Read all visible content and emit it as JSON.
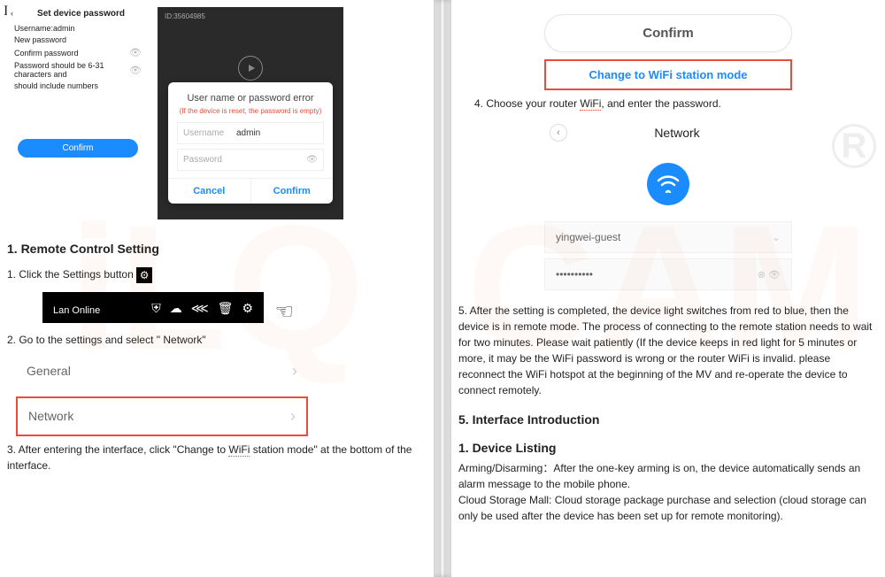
{
  "left": {
    "phone_a": {
      "title": "Set device password",
      "username": "Username:admin",
      "newpw": "New password",
      "confpw": "Confirm password",
      "hint1": "Password should be 6-31 characters and",
      "hint2": "should include numbers",
      "confirm_btn": "Confirm"
    },
    "phone_b": {
      "id_label": "ID:35604985",
      "dialog_title": "User name or password error",
      "dialog_red": "(If the device is reset, the password is empty)",
      "u_lbl": "Username",
      "u_val": "admin",
      "p_lbl": "Password",
      "cancel": "Cancel",
      "confirm": "Confirm"
    },
    "section1_h": "1. Remote Control Setting",
    "step1": "1. Click the Settings button",
    "bar_label": "Lan  Online",
    "step2": "2. Go to the settings    and select \" Network\"",
    "li_general": "General",
    "li_network": "Network",
    "step3a": "3.   After entering the interface, click \"Change to ",
    "step3_wifi": "WiFi",
    "step3b": " station mode\" at the bottom of the interface."
  },
  "right": {
    "confirm_pill": "Confirm",
    "change_mode": "Change to WiFi station mode",
    "step4a": "4.    Choose your router ",
    "step4_wifi": "WiFi",
    "step4b": ", and enter the password.",
    "net_title": "Network",
    "ssid": "yingwei-guest",
    "pw_dots": "••••••••••",
    "step5": "5. After the setting is completed, the device light switches from red to blue, then the device is in remote mode. The process of connecting to the remote station needs to wait for two minutes. Please wait patiently (If the device keeps in red light for 5 minutes or more, it may be the WiFi password is wrong or the router WiFi is invalid. please reconnect the WiFi hotspot at the beginning of the MV and re-operate the device to connect remotely.",
    "h_interface": "5. Interface Introduction",
    "h_listing": "1. Device Listing",
    "listing_body": "Arming/Disarming：After the one-key arming is on, the device automatically sends an alarm message to the mobile phone.\nCloud Storage Mall: Cloud storage package purchase and selection (cloud storage can only be used after the device has been set up for remote monitoring)."
  }
}
